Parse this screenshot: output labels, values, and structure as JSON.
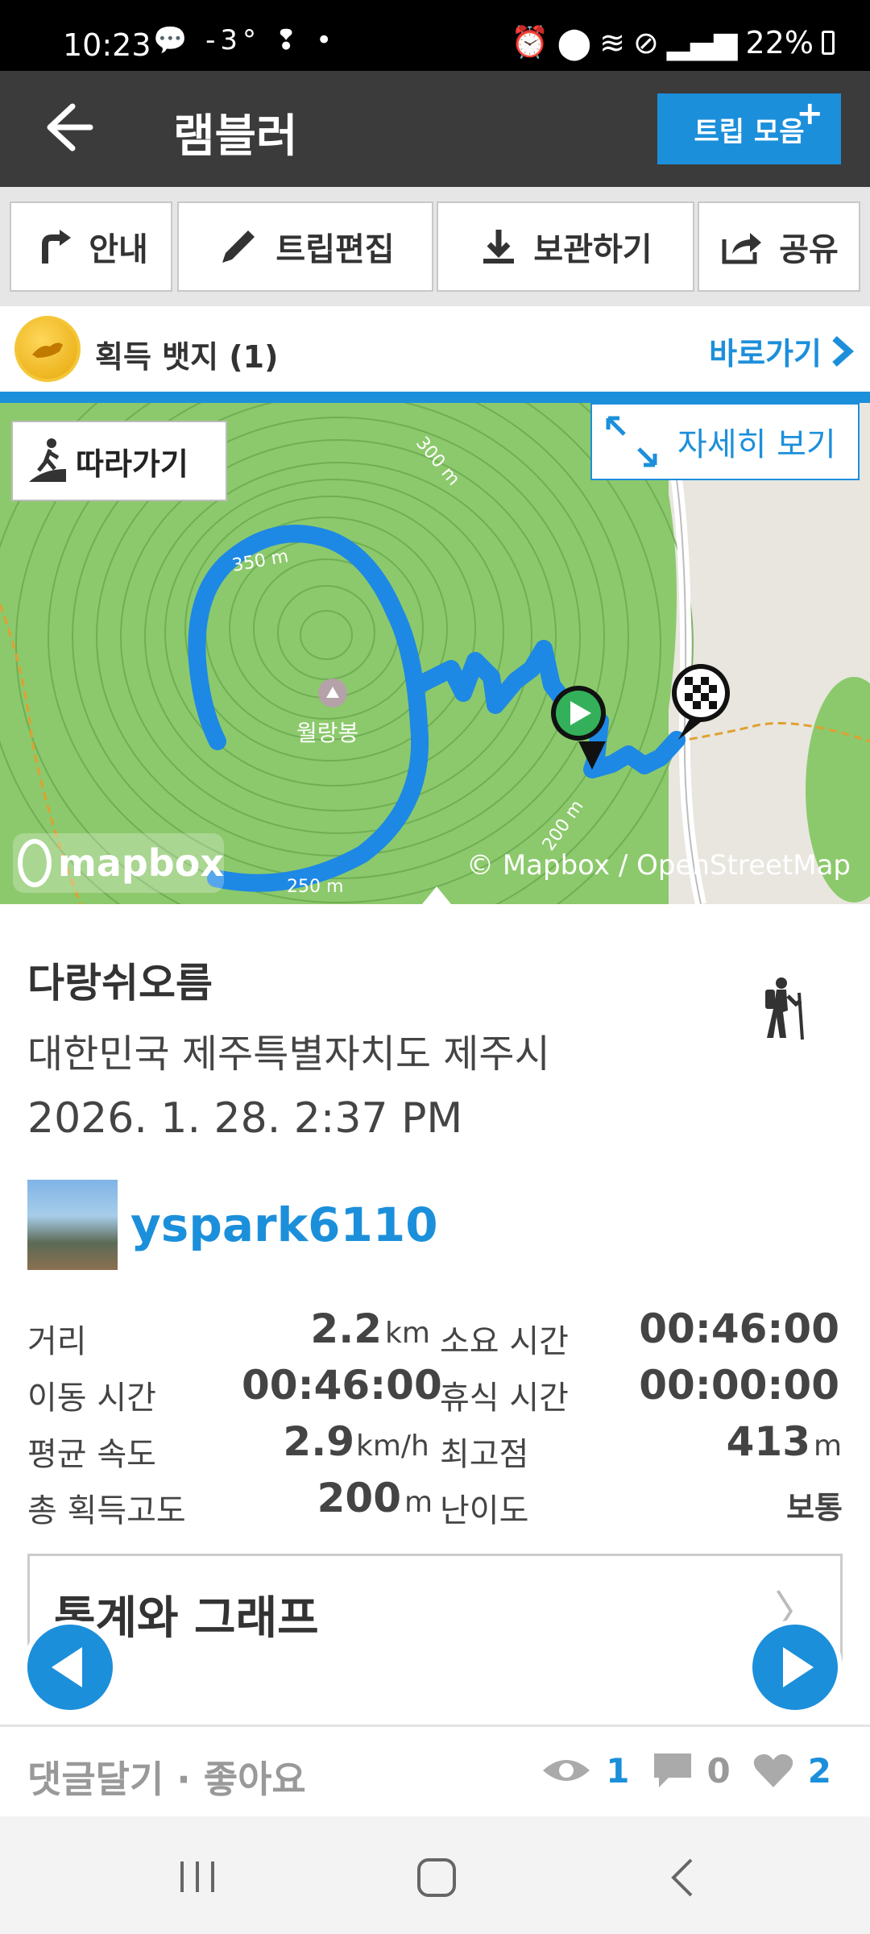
{
  "status": {
    "time": "10:23",
    "left_extra": "-3°",
    "battery": "22%"
  },
  "appbar": {
    "title": "램블러",
    "trips_button": "트립 모음",
    "trips_plus": "+"
  },
  "toolbar": {
    "guide": "안내",
    "edit": "트립편집",
    "save": "보관하기",
    "share": "공유"
  },
  "badges": {
    "label": "획득 뱃지 (1)",
    "go": "바로가기"
  },
  "map": {
    "follow": "따라가기",
    "detail": "자세히 보기",
    "peak_name": "월랑봉",
    "contours": [
      "300 m",
      "350 m",
      "200 m",
      "250 m"
    ],
    "logo": "mapbox",
    "attribution": "© Mapbox / OpenStreetMap"
  },
  "place": {
    "name": "다랑쉬오름",
    "address": "대한민국 제주특별자치도 제주시",
    "date": "2026. 1. 28. 2:37 PM",
    "activity_icon": "hiker-icon"
  },
  "user": {
    "name": "yspark6110"
  },
  "stats": {
    "distance_label": "거리",
    "distance_value": "2.2",
    "distance_unit": "km",
    "duration_label": "소요 시간",
    "duration_value": "00:46:00",
    "moving_label": "이동 시간",
    "moving_value": "00:46:00",
    "rest_label": "휴식 시간",
    "rest_value": "00:00:00",
    "speed_label": "평균 속도",
    "speed_value": "2.9",
    "speed_unit": "km/h",
    "max_label": "최고점",
    "max_value": "413",
    "max_unit": "m",
    "gain_label": "총 획득고도",
    "gain_value": "200",
    "gain_unit": "m",
    "difficulty_label": "난이도",
    "difficulty_value": "보통"
  },
  "stats_card": {
    "title": "통계와 그래프",
    "chevron": "〉"
  },
  "social": {
    "actions": "댓글달기 · 좋아요",
    "views": "1",
    "comments": "0",
    "likes": "2"
  },
  "colors": {
    "accent": "#1c8fdb",
    "appbar": "#3b3b3b",
    "track": "#1e88e5",
    "map_green": "#8cc96c"
  }
}
